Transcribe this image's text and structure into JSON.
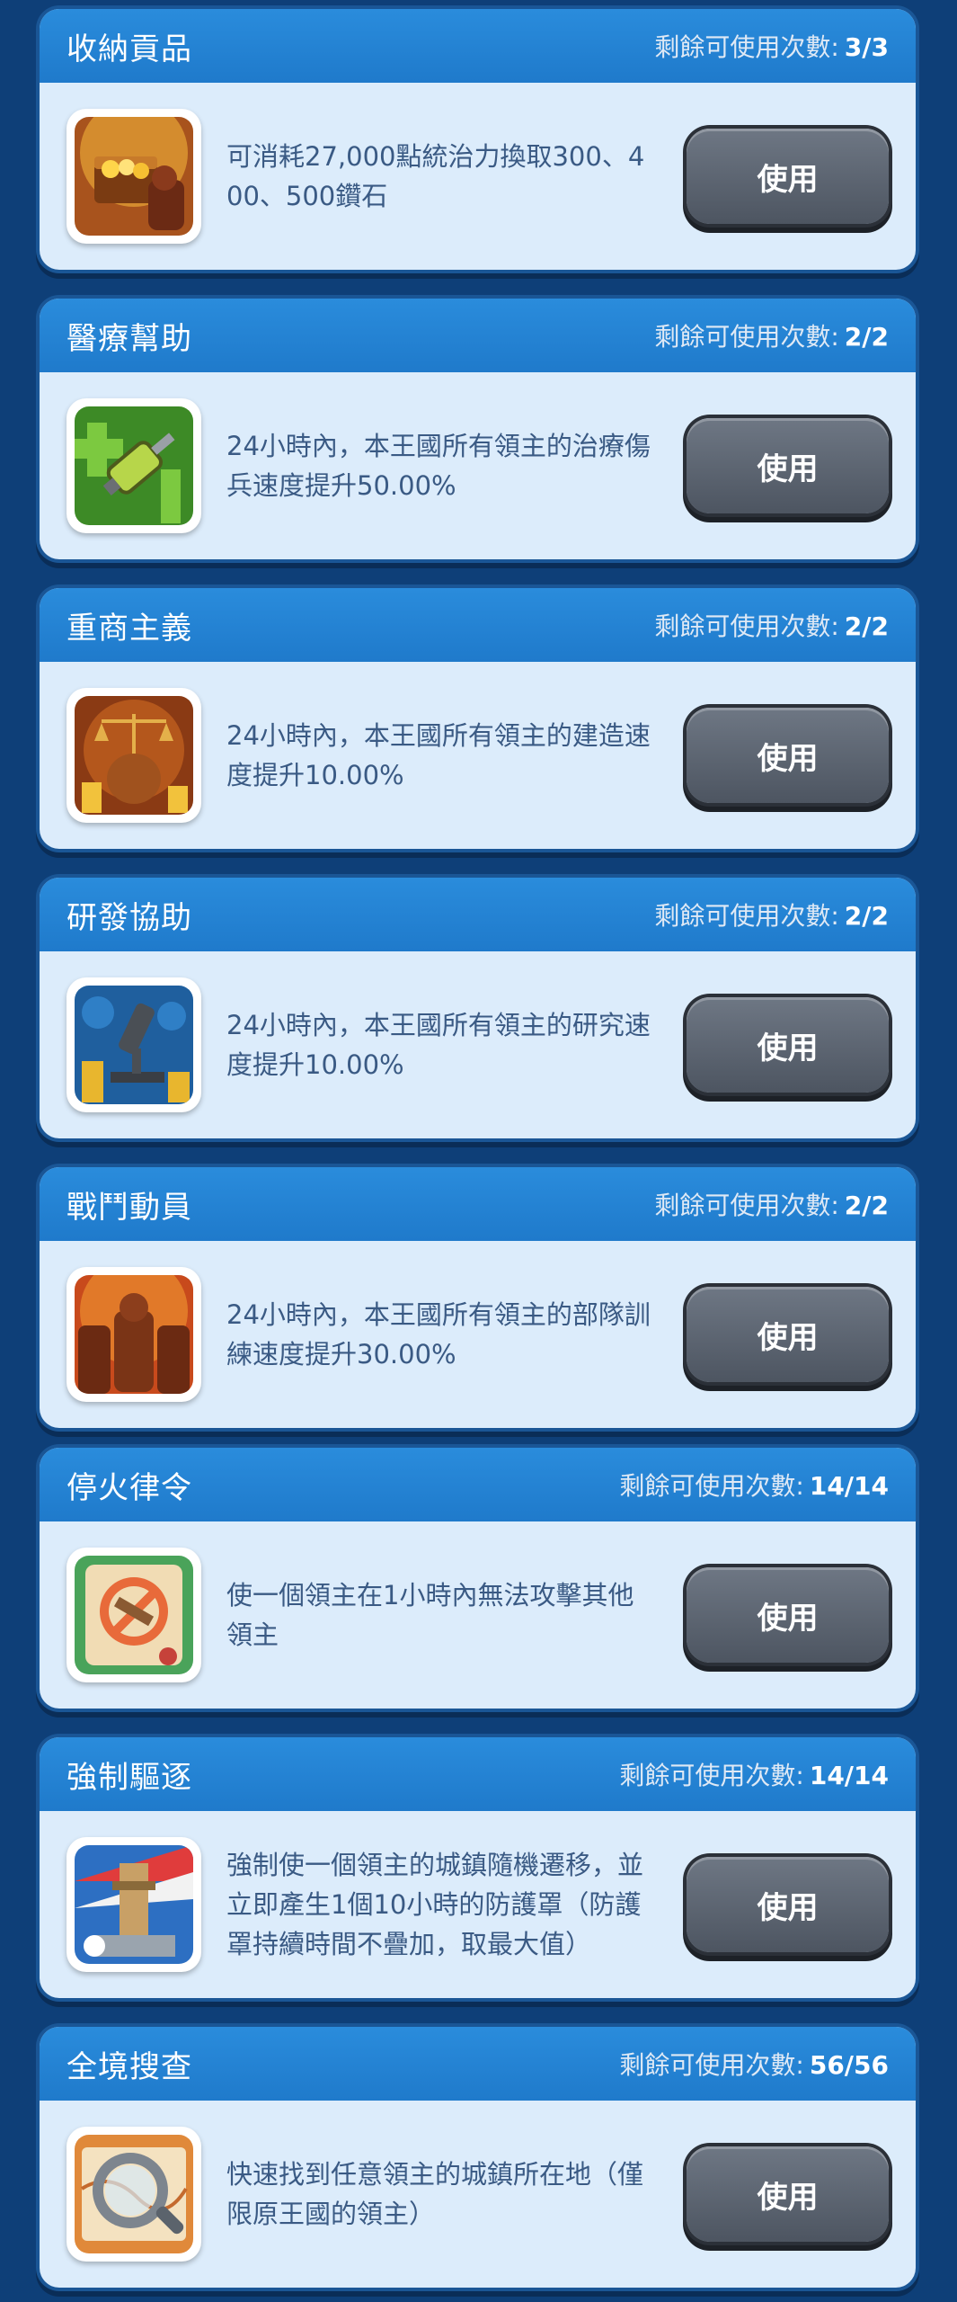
{
  "uses_label": "剩餘可使用次數:",
  "items": [
    {
      "title": "收納貢品",
      "uses": "3/3",
      "icon": "treasure-chest-icon",
      "description": "可消耗27,000點統治力換取300、400、500鑽石",
      "button": "使用"
    },
    {
      "title": "醫療幫助",
      "uses": "2/2",
      "icon": "medical-syringe-icon",
      "description": "24小時內，本王國所有領主的治療傷兵速度提升50.00%",
      "button": "使用"
    },
    {
      "title": "重商主義",
      "uses": "2/2",
      "icon": "merchant-scales-icon",
      "description": "24小時內，本王國所有領主的建造速度提升10.00%",
      "button": "使用"
    },
    {
      "title": "研發協助",
      "uses": "2/2",
      "icon": "research-microscope-icon",
      "description": "24小時內，本王國所有領主的研究速度提升10.00%",
      "button": "使用"
    },
    {
      "title": "戰鬥動員",
      "uses": "2/2",
      "icon": "troops-mobilize-icon",
      "description": "24小時內，本王國所有領主的部隊訓練速度提升30.00%",
      "button": "使用"
    },
    {
      "title": "停火律令",
      "uses": "14/14",
      "icon": "ceasefire-scroll-icon",
      "description": "使一個領主在1小時內無法攻擊其他領主",
      "button": "使用"
    },
    {
      "title": "強制驅逐",
      "uses": "14/14",
      "icon": "relocate-castle-icon",
      "description": "強制使一個領主的城鎮隨機遷移，並立即產生1個10小時的防護罩（防護罩持續時間不疊加，取最大值）",
      "button": "使用"
    },
    {
      "title": "全境搜查",
      "uses": "56/56",
      "icon": "search-map-icon",
      "description": "快速找到任意領主的城鎮所在地（僅限原王國的領主）",
      "button": "使用"
    }
  ]
}
